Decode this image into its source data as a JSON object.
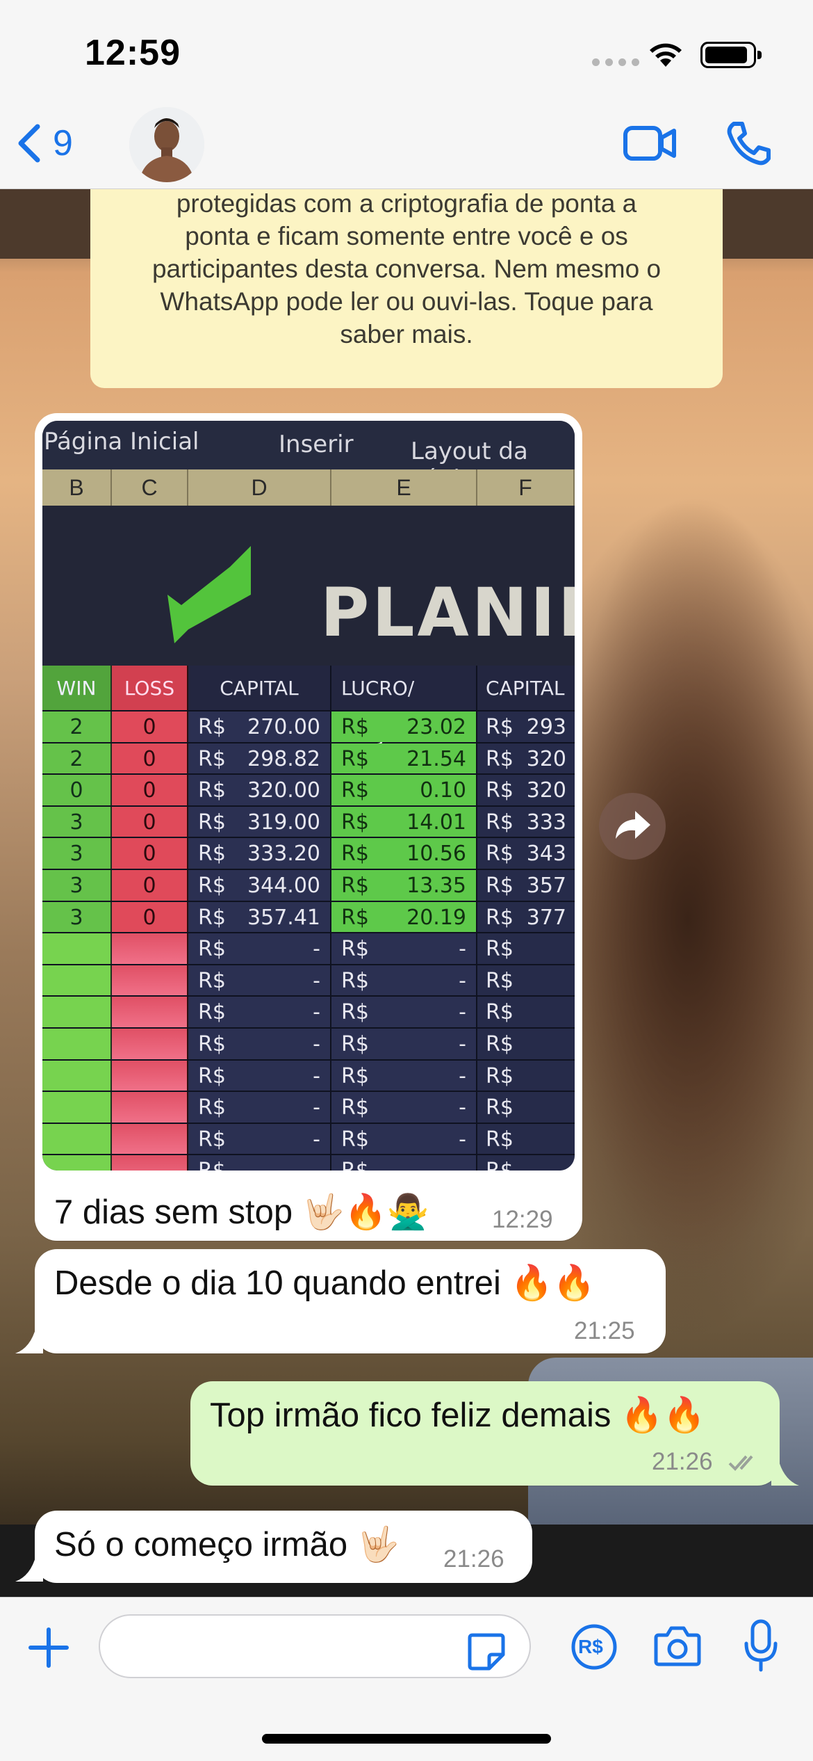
{
  "status_bar": {
    "time": "12:59"
  },
  "header": {
    "back_count": "9"
  },
  "encryption_notice": {
    "lines": [
      "protegidas com a criptografia de ponta a",
      "ponta e ficam somente entre você e os",
      "participantes desta conversa. Nem mesmo o",
      "WhatsApp pode ler ou ouvi-las. Toque para",
      "saber mais."
    ]
  },
  "spreadsheet": {
    "tabs": [
      "Página Inicial",
      "Inserir",
      "Layout da Pági"
    ],
    "columns": [
      "B",
      "C",
      "D",
      "E",
      "F"
    ],
    "banner": "PLANILI",
    "headers": [
      "WIN",
      "LOSS",
      "CAPITAL",
      "LUCRO/ PREJU",
      "CAPITAL F"
    ],
    "currency": "R$",
    "rows": [
      {
        "win": "2",
        "loss": "0",
        "capital": "270.00",
        "lucro": "23.02",
        "capital_f": "293"
      },
      {
        "win": "2",
        "loss": "0",
        "capital": "298.82",
        "lucro": "21.54",
        "capital_f": "320"
      },
      {
        "win": "0",
        "loss": "0",
        "capital": "320.00",
        "lucro": "0.10",
        "capital_f": "320"
      },
      {
        "win": "3",
        "loss": "0",
        "capital": "319.00",
        "lucro": "14.01",
        "capital_f": "333"
      },
      {
        "win": "3",
        "loss": "0",
        "capital": "333.20",
        "lucro": "10.56",
        "capital_f": "343"
      },
      {
        "win": "3",
        "loss": "0",
        "capital": "344.00",
        "lucro": "13.35",
        "capital_f": "357"
      },
      {
        "win": "3",
        "loss": "0",
        "capital": "357.41",
        "lucro": "20.19",
        "capital_f": "377"
      }
    ],
    "empty_value": "-"
  },
  "messages": {
    "m1": {
      "text": "7 dias sem stop 🤟🏻🔥🙅‍♂️",
      "time": "12:29"
    },
    "m2": {
      "text": "Desde o dia 10 quando entrei 🔥🔥",
      "time": "21:25"
    },
    "m3": {
      "text": "Top irmão fico feliz demais 🔥🔥",
      "time": "21:26"
    },
    "m4": {
      "text": "Só o começo irmão 🤟🏻",
      "time": "21:26"
    }
  },
  "composer": {
    "placeholder": "",
    "pix_label": "R$"
  },
  "colors": {
    "accent": "#1a73e8",
    "outgoing_bubble": "#dcf8c6",
    "encryption_bg": "#fcf4c4"
  }
}
